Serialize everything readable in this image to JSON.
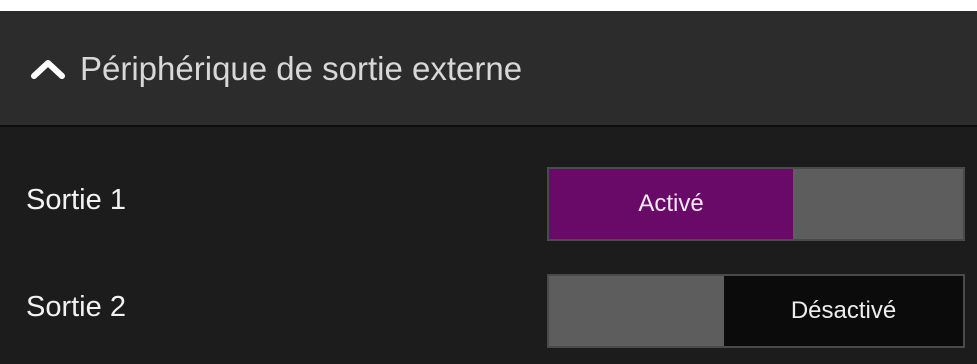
{
  "section": {
    "title": "Périphérique de sortie externe",
    "expand_icon": "chevron-up-icon"
  },
  "outputs": [
    {
      "label": "Sortie 1",
      "state": "on",
      "on_label": "Activé",
      "off_label": ""
    },
    {
      "label": "Sortie 2",
      "state": "off",
      "on_label": "",
      "off_label": "Désactivé"
    }
  ],
  "colors": {
    "panel_bg": "#1c1c1c",
    "header_bg": "#2c2c2c",
    "active_on": "#6a0a68",
    "inactive_segment": "#5d5d5d",
    "active_off": "#0b0b0b"
  }
}
